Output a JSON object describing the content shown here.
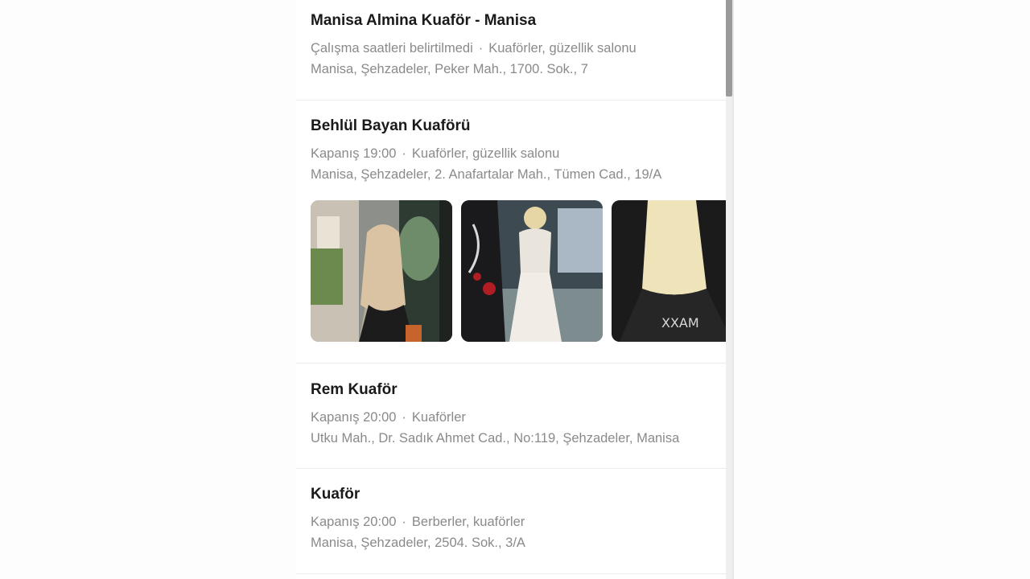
{
  "results": [
    {
      "name": "Manisa Almina Kuaför - Manisa",
      "hours": "Çalışma saatleri belirtilmedi",
      "category": "Kuaförler, güzellik salonu",
      "address": "Manisa, Şehzadeler, Peker Mah., 1700. Sok., 7"
    },
    {
      "name": "Behlül Bayan Kuaförü",
      "hours": "Kapanış 19:00",
      "category": "Kuaförler, güzellik salonu",
      "address": "Manisa, Şehzadeler, 2. Anafartalar Mah., Tümen Cad., 19/A",
      "photo_text": "XXAM"
    },
    {
      "name": "Rem Kuaför",
      "hours": "Kapanış 20:00",
      "category": "Kuaförler",
      "address": "Utku Mah., Dr. Sadık Ahmet Cad., No:119, Şehzadeler, Manisa"
    },
    {
      "name": "Kuaför",
      "hours": "Kapanış 20:00",
      "category": "Berberler, kuaförler",
      "address": "Manisa, Şehzadeler, 2504. Sok., 3/A"
    }
  ],
  "separator": "·",
  "colors": {
    "title": "#1a1a1a",
    "meta": "#8a8a8a",
    "divider": "#ececec",
    "scrollbar_thumb": "#9a9a9a"
  }
}
